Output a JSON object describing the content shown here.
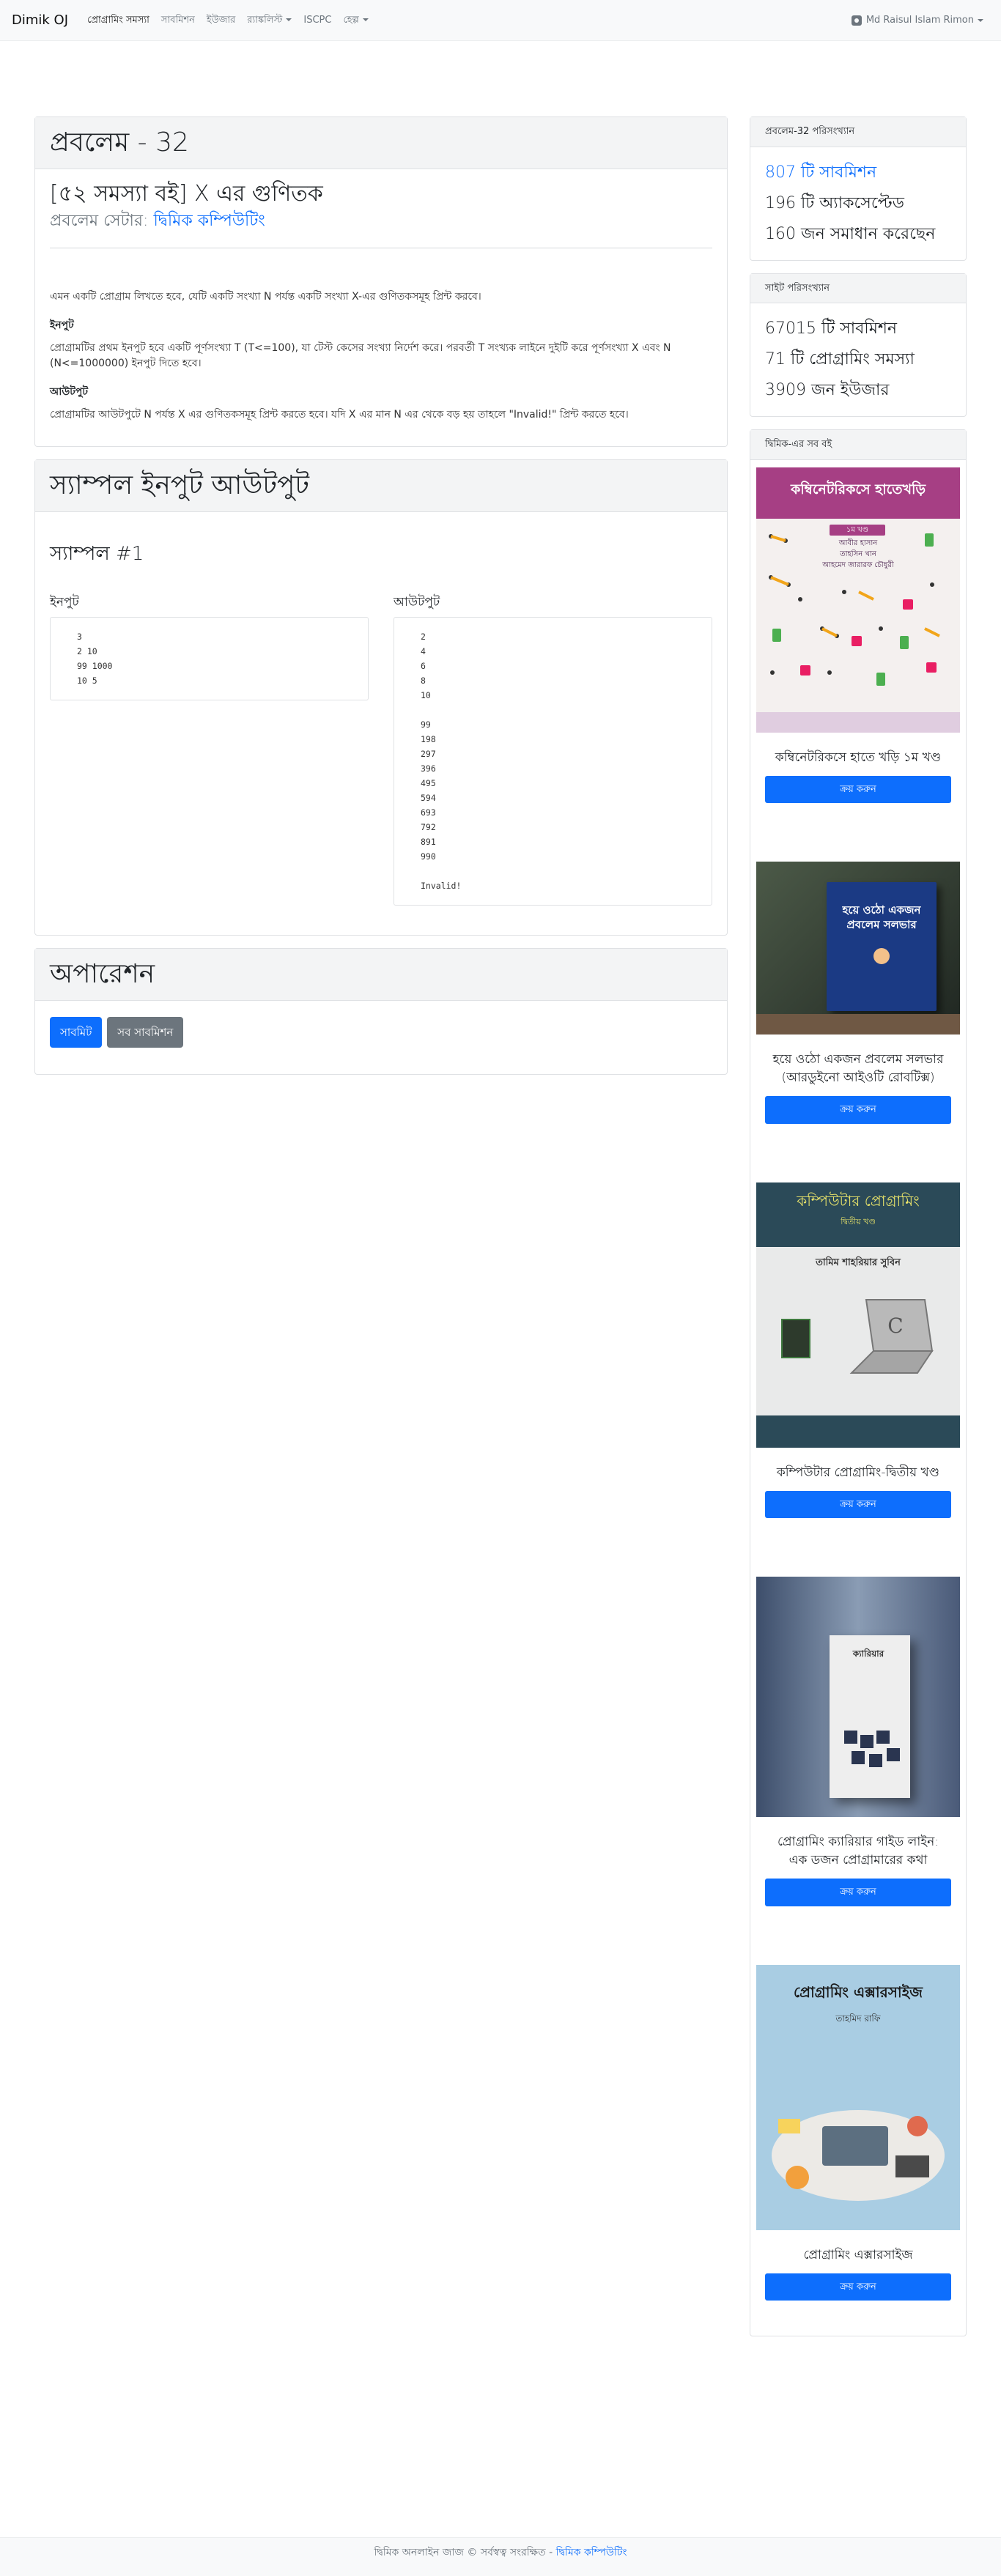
{
  "nav": {
    "brand": "Dimik OJ",
    "links": [
      "প্রোগ্রামিং সমস্যা",
      "সাবমিশন",
      "ইউজার",
      "র‍্যাঙ্কলিস্ট",
      "ISCPC",
      "হেল্প"
    ],
    "user": "Md Raisul Islam Rimon"
  },
  "problem": {
    "heading": "প্রবলেম - 32",
    "title": "[৫২ সমস্যা বই] X এর গুণিতক",
    "setter_label": "প্রবলেম সেটার:",
    "setter_name": "দ্বিমিক কম্পিউটিং",
    "statement": "এমন একটি প্রোগ্রাম লিখতে হবে, যেটি একটি সংখ্যা N পর্যন্ত একটি সংখ্যা X-এর গুণিতকসমূহ প্রিন্ট করবে।",
    "input_heading": "ইনপুট",
    "input_text": "প্রোগ্রামটির প্রথম ইনপুট হবে একটি পূর্ণসংখ্যা T (T<=100), যা টেস্ট কেসের সংখ্যা নির্দেশ করে। পরবর্তী T সংখ্যক লাইনে দুইটি করে পূর্ণসংখ্যা X এবং N (N<=1000000) ইনপুট দিতে হবে।",
    "output_heading": "আউটপুট",
    "output_text": "প্রোগ্রামটির আউটপুটে N পর্যন্ত X এর গুণিতকসমূহ প্রিন্ট করতে হবে। যদি X এর মান N এর থেকে বড় হয় তাহলে \"Invalid!\" প্রিন্ট করতে হবে।"
  },
  "samples": {
    "heading": "স্যাম্পল ইনপুট আউটপুট",
    "sample_title": "স্যাম্পল #1",
    "input_label": "ইনপুট",
    "output_label": "আউটপুট",
    "input": "3\n2 10\n99 1000\n10 5",
    "output": "2\n4\n6\n8\n10\n\n99\n198\n297\n396\n495\n594\n693\n792\n891\n990\n\nInvalid!"
  },
  "operations": {
    "heading": "অপারেশন",
    "submit": "সাবমিট",
    "all_submissions": "সব সাবমিশন"
  },
  "problem_stats": {
    "header": "প্রবলেম-32 পরিসংখ্যান",
    "submissions": "807 টি সাবমিশন",
    "accepted": "196 টি অ্যাকসেপ্টেড",
    "solvers": "160 জন সমাধান করেছেন"
  },
  "site_stats": {
    "header": "সাইট পরিসংখ্যান",
    "submissions": "67015 টি সাবমিশন",
    "problems": "71 টি প্রোগ্রামিং সমস্যা",
    "users": "3909 জন ইউজার"
  },
  "books": {
    "header": "দ্বিমিক-এর সব বই",
    "buy_label": "ক্রয় করুন",
    "items": [
      {
        "title": "কম্বিনেটরিকসে হাতে খড়ি ১ম খণ্ড",
        "cover_text": "কম্বিনেটরিকসে হাতেখড়ি",
        "cover_sub": "আবীর হাসান\nতাহসিন খান\nআহমেদ জারারফ চৌধুরী",
        "badge": "১ম খণ্ড"
      },
      {
        "title": "হয়ে ওঠো একজন প্রবলেম সলভার (আরডুইনো আইওটি রোবটিক্স)",
        "cover_text": "হয়ে ওঠো একজন প্রবলেম সলভার"
      },
      {
        "title": "কম্পিউটার প্রোগ্রামিং-দ্বিতীয় খণ্ড",
        "cover_text": "কম্পিউটার প্রোগ্রামিং",
        "cover_sub": "দ্বিতীয় খণ্ড",
        "author": "তামিম শাহরিয়ার সুবিন"
      },
      {
        "title": "প্রোগ্রামিং ক্যারিয়ার গাইড লাইন: এক ডজন প্রোগ্রামারের কথা",
        "cover_text": "ক্যারিয়ার"
      },
      {
        "title": "প্রোগ্রামিং এক্সারসাইজ",
        "cover_text": "প্রোগ্রামিং এক্সারসাইজ",
        "author": "তাহমিদ রাফি"
      }
    ]
  },
  "footer": {
    "text": "দ্বিমিক অনলাইন জাজ © সর্বস্বত্ব সংরক্ষিত -",
    "link": "দ্বিমিক কম্পিউটিং"
  },
  "colors": {
    "primary": "#0d6efd",
    "secondary": "#6c757d",
    "card_header": "#f3f4f5"
  }
}
